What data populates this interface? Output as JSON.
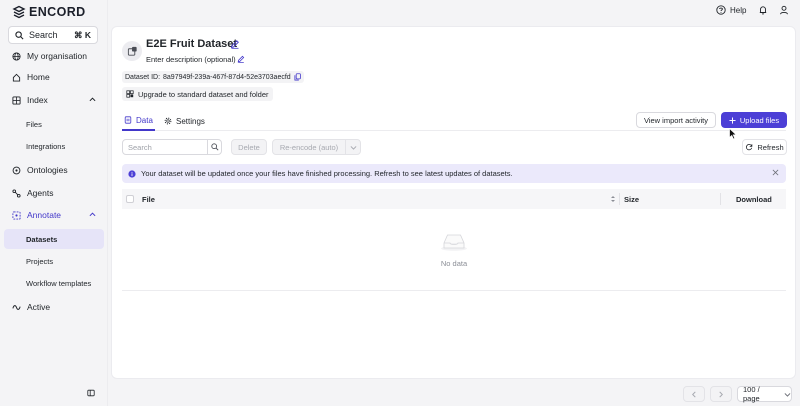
{
  "app": {
    "name": "ENCORD"
  },
  "sidebar": {
    "search": {
      "label": "Search",
      "shortcut": "⌘ K"
    },
    "items": [
      {
        "label": "My organisation",
        "icon": "globe-icon"
      },
      {
        "label": "Home",
        "icon": "home-icon"
      },
      {
        "label": "Index",
        "icon": "index-icon",
        "expanded": true,
        "children": [
          {
            "label": "Files"
          },
          {
            "label": "Integrations"
          }
        ]
      },
      {
        "label": "Ontologies",
        "icon": "ontology-icon"
      },
      {
        "label": "Agents",
        "icon": "agents-icon"
      },
      {
        "label": "Annotate",
        "icon": "annotate-icon",
        "expanded": true,
        "active": true,
        "children": [
          {
            "label": "Datasets",
            "selected": true
          },
          {
            "label": "Projects"
          },
          {
            "label": "Workflow templates"
          }
        ]
      },
      {
        "label": "Active",
        "icon": "active-icon"
      }
    ]
  },
  "topbar": {
    "help_label": "Help"
  },
  "dataset": {
    "title": "E2E Fruit Dataset",
    "description_placeholder": "Enter description (optional)",
    "id_label": "Dataset ID:",
    "id_value": "8a97949f-239a-467f-87d4-52e3703aecfd",
    "upgrade_label": "Upgrade to standard dataset and folder"
  },
  "tabs": [
    {
      "label": "Data",
      "icon": "data-icon",
      "active": true
    },
    {
      "label": "Settings",
      "icon": "gear-icon",
      "active": false
    }
  ],
  "actions": {
    "view_import": "View import activity",
    "upload": "Upload files",
    "upload_icon": "plus-icon"
  },
  "toolbar": {
    "search_placeholder": "Search",
    "delete_label": "Delete",
    "reencode_label": "Re-encode (auto)",
    "refresh_label": "Refresh"
  },
  "banner": {
    "text": "Your dataset will be updated once your files have finished processing. Refresh to see latest updates of datasets.",
    "color": "#ebe9fb"
  },
  "table": {
    "columns": [
      "File",
      "Size",
      "Download"
    ],
    "rows": [],
    "empty_text": "No data"
  },
  "pagination": {
    "page_size": "100 / page"
  },
  "colors": {
    "accent": "#4c3fd6",
    "active_text": "#4338ca",
    "selected_bg": "#e6e4f8"
  }
}
